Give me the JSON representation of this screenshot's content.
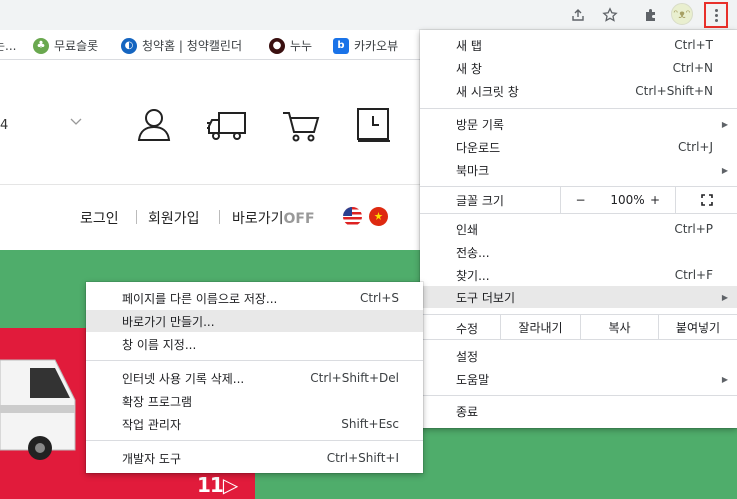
{
  "browser": {
    "bookmarks": [
      {
        "label": "는...",
        "fav_color": "#c7c7c7"
      },
      {
        "label": "무료슬롯",
        "fav_color": "#6aa84f"
      },
      {
        "label": "청약홈 | 청약캘린더",
        "fav_color": "#1565c0"
      },
      {
        "label": "누누",
        "fav_color": "#3a1010"
      },
      {
        "label": "카카오뷰",
        "fav_color": "#1a73e8",
        "fav_text": "b"
      }
    ]
  },
  "page": {
    "digit": "4",
    "links": {
      "login": "로그인",
      "signup": "회원가입",
      "shortcut": "바로가기",
      "shortcut_state": "OFF"
    },
    "banner_logo": "11"
  },
  "main_menu": {
    "new_tab": {
      "label": "새 탭",
      "shortcut": "Ctrl+T"
    },
    "new_window": {
      "label": "새 창",
      "shortcut": "Ctrl+N"
    },
    "incognito": {
      "label": "새 시크릿 창",
      "shortcut": "Ctrl+Shift+N"
    },
    "history": {
      "label": "방문 기록"
    },
    "downloads": {
      "label": "다운로드",
      "shortcut": "Ctrl+J"
    },
    "bookmarks": {
      "label": "북마크"
    },
    "zoom": {
      "label": "글꼴 크기",
      "minus": "−",
      "value": "100%",
      "plus": "+"
    },
    "print": {
      "label": "인쇄",
      "shortcut": "Ctrl+P"
    },
    "cast": {
      "label": "전송..."
    },
    "find": {
      "label": "찾기...",
      "shortcut": "Ctrl+F"
    },
    "more_tools": {
      "label": "도구 더보기"
    },
    "edit": {
      "label": "수정",
      "cut": "잘라내기",
      "copy": "복사",
      "paste": "붙여넣기"
    },
    "settings": {
      "label": "설정"
    },
    "help": {
      "label": "도움말"
    },
    "exit": {
      "label": "종료"
    }
  },
  "sub_menu": {
    "save_page": {
      "label": "페이지를 다른 이름으로 저장...",
      "shortcut": "Ctrl+S"
    },
    "create_shortcut": {
      "label": "바로가기 만들기..."
    },
    "name_window": {
      "label": "창 이름 지정..."
    },
    "clear_data": {
      "label": "인터넷 사용 기록 삭제...",
      "shortcut": "Ctrl+Shift+Del"
    },
    "extensions": {
      "label": "확장 프로그램"
    },
    "task_manager": {
      "label": "작업 관리자",
      "shortcut": "Shift+Esc"
    },
    "dev_tools": {
      "label": "개발자 도구",
      "shortcut": "Ctrl+Shift+I"
    }
  },
  "colors": {
    "banner_green": "#4fad6b",
    "banner_red": "#e11b3b",
    "highlight": "#e8e8e8",
    "menu_button_border": "#e8302a"
  }
}
